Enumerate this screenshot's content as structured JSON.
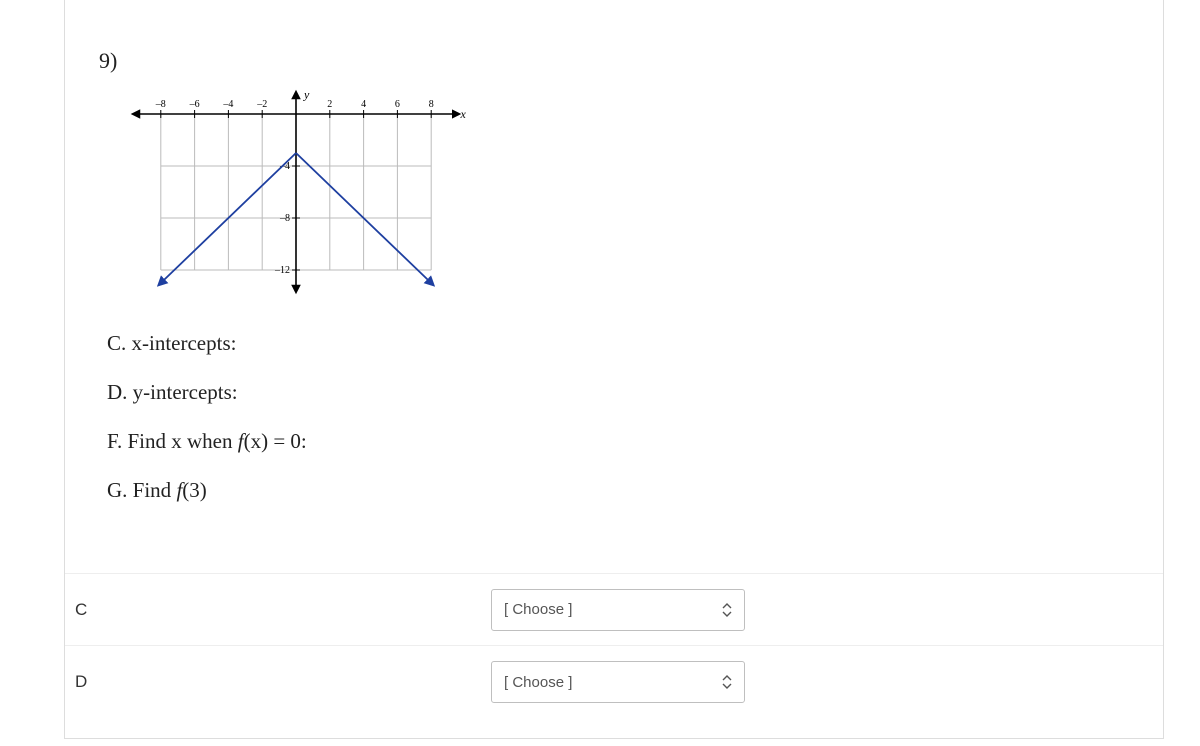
{
  "question_number": "9)",
  "graph": {
    "x_axis_label": "x",
    "y_axis_label": "y",
    "x_ticks": [
      -8,
      -6,
      -4,
      -2,
      2,
      4,
      6,
      8
    ],
    "y_ticks": [
      -4,
      -8,
      -12
    ],
    "x_range": [
      -10,
      10
    ],
    "y_range": [
      -14,
      2
    ],
    "lines": [
      {
        "points": [
          [
            -8,
            -13
          ],
          [
            0,
            -3
          ]
        ],
        "color": "#1e3fa0"
      },
      {
        "points": [
          [
            0,
            -3
          ],
          [
            8,
            -13
          ]
        ],
        "color": "#1e3fa0"
      }
    ]
  },
  "prompts": {
    "c": "C. x-intercepts:",
    "d": "D. y-intercepts:",
    "f_prefix": "F. Find x when ",
    "f_func": "f",
    "f_arg": "(x)",
    "f_suffix": " = 0:",
    "g_prefix": "G. Find ",
    "g_func": "f",
    "g_arg": "(3)"
  },
  "answers": [
    {
      "label": "C",
      "dropdown": "[ Choose ]"
    },
    {
      "label": "D",
      "dropdown": "[ Choose ]"
    }
  ],
  "chart_data": {
    "type": "line",
    "title": "",
    "xlabel": "x",
    "ylabel": "y",
    "x": [
      -8,
      0,
      8
    ],
    "y": [
      -13,
      -3,
      -13
    ],
    "xlim": [
      -10,
      10
    ],
    "ylim": [
      -14,
      2
    ],
    "x_ticks": [
      -8,
      -6,
      -4,
      -2,
      2,
      4,
      6,
      8
    ],
    "y_ticks": [
      -4,
      -8,
      -12
    ]
  }
}
